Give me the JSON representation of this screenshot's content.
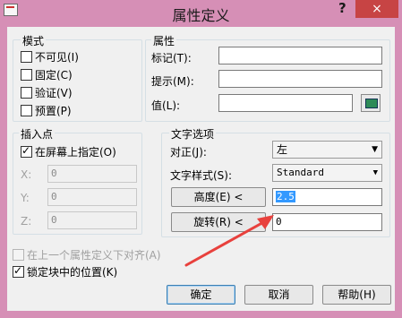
{
  "window": {
    "title": "属性定义",
    "help": "?",
    "close": "×"
  },
  "mode": {
    "title": "模式",
    "items": [
      {
        "label": "不可见(I)",
        "checked": false
      },
      {
        "label": "固定(C)",
        "checked": false
      },
      {
        "label": "验证(V)",
        "checked": false
      },
      {
        "label": "预置(P)",
        "checked": false
      }
    ]
  },
  "attribute": {
    "title": "属性",
    "tag_label": "标记(T):",
    "tag_value": "",
    "prompt_label": "提示(M):",
    "prompt_value": "",
    "value_label": "值(L):",
    "value_value": ""
  },
  "insertion": {
    "title": "插入点",
    "specify_label": "在屏幕上指定(O)",
    "specify_checked": true,
    "x_label": "X:",
    "x_value": "0",
    "y_label": "Y:",
    "y_value": "0",
    "z_label": "Z:",
    "z_value": "0"
  },
  "text": {
    "title": "文字选项",
    "justify_label": "对正(J):",
    "justify_value": "左",
    "style_label": "文字样式(S):",
    "style_value": "Standard",
    "height_button": "高度(E) <",
    "height_value": "2.5",
    "rotation_button": "旋转(R) <",
    "rotation_value": "0"
  },
  "align_below": {
    "label": "在上一个属性定义下对齐(A)",
    "checked": false,
    "disabled": true
  },
  "lock_position": {
    "label": "锁定块中的位置(K)",
    "checked": true
  },
  "buttons": {
    "ok": "确定",
    "cancel": "取消",
    "help": "帮助(H)"
  }
}
